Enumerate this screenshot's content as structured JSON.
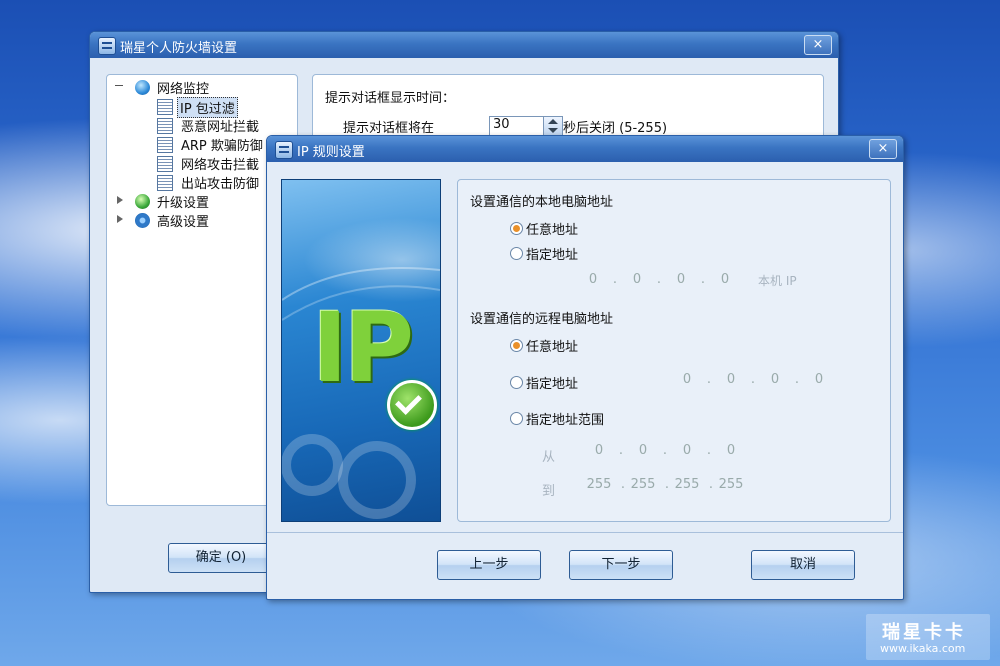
{
  "main_window": {
    "title": "瑞星个人防火墙设置",
    "close_symbol": "×",
    "tree": {
      "network_monitor": "网络监控",
      "ip_filter": "IP 包过滤",
      "malicious_url": "恶意网址拦截",
      "arp": "ARP 欺骗防御",
      "net_attack": "网络攻击拦截",
      "outbound_attack": "出站攻击防御",
      "upgrade": "升级设置",
      "advanced": "高级设置"
    },
    "right": {
      "heading": "提示对话框显示时间：",
      "row_label": "提示对话框将在",
      "seconds_value": "30",
      "row_suffix": "秒后关闭 (5-255)"
    },
    "ok_button": "确定 (O)"
  },
  "dialog": {
    "title": "IP 规则设置",
    "close_symbol": "×",
    "banner_text": "IP",
    "local_section": {
      "heading": "设置通信的本地电脑地址",
      "any_label": "任意地址",
      "specific_label": "指定地址",
      "ip": [
        "0",
        "0",
        "0",
        "0"
      ],
      "local_ip_button": "本机 IP",
      "selected": "any"
    },
    "remote_section": {
      "heading": "设置通信的远程电脑地址",
      "any_label": "任意地址",
      "specific_label": "指定地址",
      "specific_ip": [
        "0",
        "0",
        "0",
        "0"
      ],
      "range_label": "指定地址范围",
      "from_label": "从",
      "to_label": "到",
      "from_ip": [
        "0",
        "0",
        "0",
        "0"
      ],
      "to_ip": [
        "255",
        "255",
        "255",
        "255"
      ],
      "selected": "any"
    },
    "buttons": {
      "prev": "上一步",
      "next": "下一步",
      "cancel": "取消"
    }
  },
  "watermark": {
    "brand": "瑞星卡卡",
    "url": "www.ikaka.com"
  },
  "colors": {
    "title_blue": "#3a74c2",
    "radio_selected": "#e9902a",
    "banner_blue": "#1f78c8"
  }
}
